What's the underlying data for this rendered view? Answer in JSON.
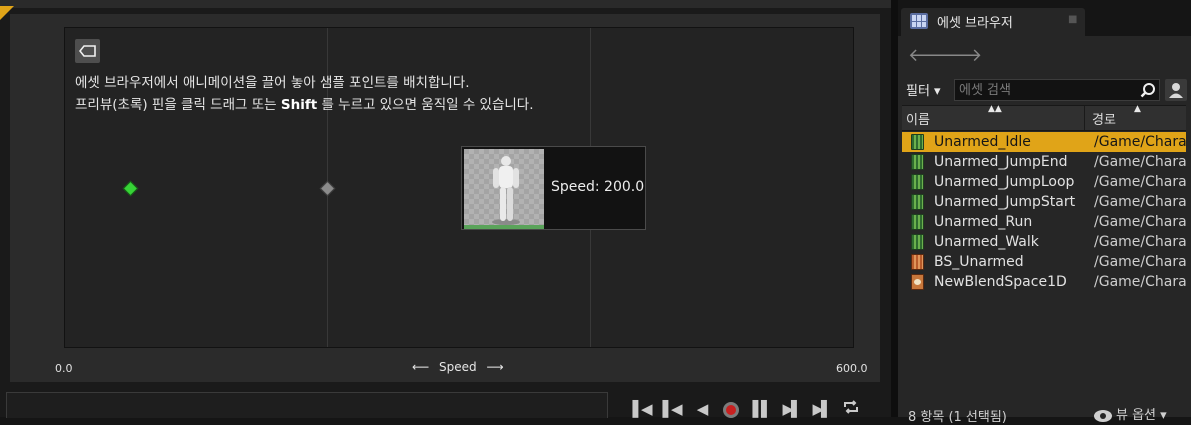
{
  "editor": {
    "hint_line1": "에셋 브라우저에서 애니메이션을 끌어 놓아 샘플 포인트를 배치합니다.",
    "hint_line2_pre": "프리뷰(초록) 핀을 클릭 드래그 또는 ",
    "hint_line2_key": "Shift",
    "hint_line2_post": " 를 누르고 있으면 움직일 수 있습니다.",
    "preview_label": "Speed: 200.0",
    "axis": {
      "min": "0.0",
      "max": "600.0",
      "name": "Speed",
      "left_arrow": "⟵",
      "right_arrow": "⟶"
    },
    "transport": [
      "▌◀",
      "▌◀",
      "◀",
      "record",
      "▌▌",
      "▶▌",
      "▶▌",
      "loop"
    ]
  },
  "asset_browser": {
    "tab_title": "에셋 브라우저",
    "tab_close": "■",
    "back_arrow": "🡐",
    "forward_arrow": "🡒",
    "filter_label": "필터 ▾",
    "search_placeholder": "에셋 검색",
    "columns": {
      "name": "이름",
      "path": "경로"
    },
    "assets": [
      {
        "name": "Unarmed_Idle",
        "path": "/Game/Chara",
        "icon": "anim-sequence-icon",
        "selected": true
      },
      {
        "name": "Unarmed_JumpEnd",
        "path": "/Game/Chara",
        "icon": "anim-sequence-icon"
      },
      {
        "name": "Unarmed_JumpLoop",
        "path": "/Game/Chara",
        "icon": "anim-sequence-icon"
      },
      {
        "name": "Unarmed_JumpStart",
        "path": "/Game/Chara",
        "icon": "anim-sequence-icon"
      },
      {
        "name": "Unarmed_Run",
        "path": "/Game/Chara",
        "icon": "anim-sequence-icon"
      },
      {
        "name": "Unarmed_Walk",
        "path": "/Game/Chara",
        "icon": "anim-sequence-icon"
      },
      {
        "name": "BS_Unarmed",
        "path": "/Game/Chara",
        "icon": "blend-space-icon"
      },
      {
        "name": "NewBlendSpace1D",
        "path": "/Game/Chara",
        "icon": "blend-space-1d-icon"
      }
    ],
    "status": "8 항목 (1 선택됨)",
    "view_options": "뷰 옵션 ▾"
  },
  "colors": {
    "accent": "#e0a418",
    "preview_pin": "#37d337",
    "sample_pin": "#8b8b8b",
    "record": "#c82020"
  }
}
